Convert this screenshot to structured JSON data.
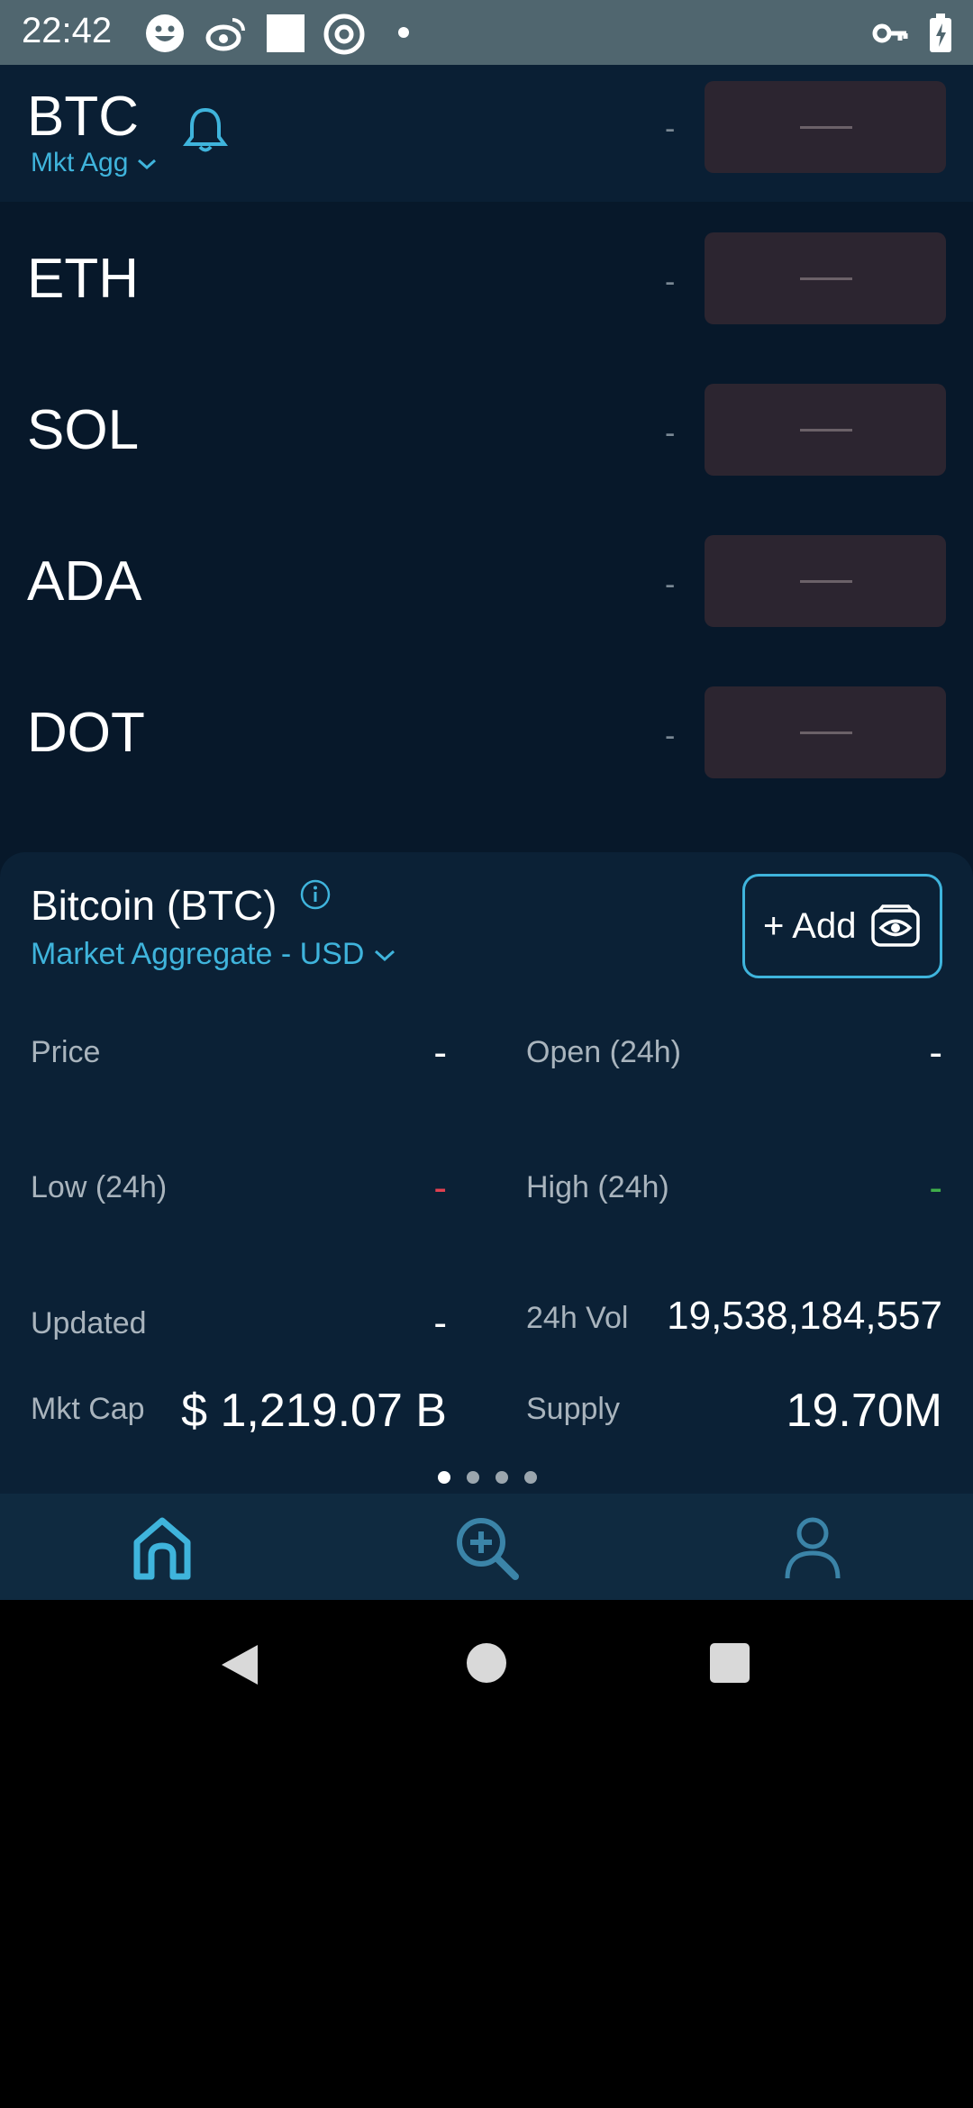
{
  "status_bar": {
    "time": "22:42"
  },
  "watchlist": [
    {
      "symbol": "BTC",
      "sub": "Mkt Agg",
      "change": "-"
    },
    {
      "symbol": "ETH",
      "change": "-"
    },
    {
      "symbol": "SOL",
      "change": "-"
    },
    {
      "symbol": "ADA",
      "change": "-"
    },
    {
      "symbol": "DOT",
      "change": "-"
    }
  ],
  "detail": {
    "title": "Bitcoin (BTC)",
    "market": "Market Aggregate - USD",
    "add_label": "+ Add",
    "price_label": "Price",
    "price_value": "-",
    "open_label": "Open (24h)",
    "open_value": "-",
    "low_label": "Low (24h)",
    "low_value": "-",
    "high_label": "High (24h)",
    "high_value": "-",
    "updated_label": "Updated",
    "updated_value": "-",
    "vol_label": "24h Vol",
    "vol_value": "19,538,184,557",
    "mktcap_label": "Mkt Cap",
    "mktcap_value": "$ 1,219.07 B",
    "supply_label": "Supply",
    "supply_value": "19.70M"
  },
  "colors": {
    "accent": "#3fb4dc",
    "low": "#e04050",
    "high": "#3fae4a"
  },
  "nav": [
    "home-icon",
    "search-add-icon",
    "profile-icon"
  ],
  "pager": {
    "pages": 4,
    "active": 1
  }
}
